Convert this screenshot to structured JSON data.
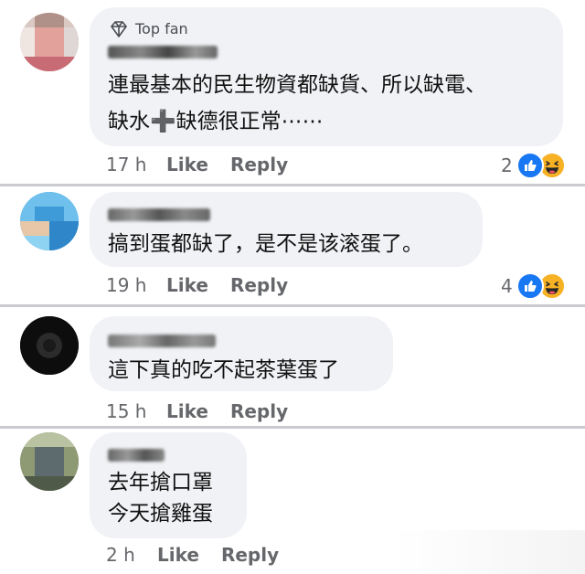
{
  "comments": [
    {
      "badge": "Top fan",
      "author": "Mary Chan",
      "lines": [
        "連最基本的民生物資都缺貨、所以缺電、",
        "缺水➕缺德很正常⋯⋯"
      ],
      "time": "17 h",
      "like_label": "Like",
      "reply_label": "Reply",
      "reactions_count": "2"
    },
    {
      "author": "Steven Wei",
      "lines": [
        "搞到蛋都缺了，是不是该滚蛋了。"
      ],
      "time": "19 h",
      "like_label": "Like",
      "reply_label": "Reply",
      "reactions_count": "4"
    },
    {
      "author": "Fortner Leo",
      "lines": [
        "這下真的吃不起茶葉蛋了"
      ],
      "time": "15 h",
      "like_label": "Like",
      "reply_label": "Reply"
    },
    {
      "author": "",
      "lines": [
        "去年搶口罩",
        "今天搶雞蛋"
      ],
      "time": "2 h",
      "like_label": "Like",
      "reply_label": "Reply"
    }
  ],
  "icons": [
    "diamond-icon",
    "like-reaction-icon",
    "haha-reaction-icon"
  ],
  "colors": {
    "bubble": "#f0f2f5",
    "meta_text": "#65676b",
    "like_blue": "#1877f2",
    "haha_yellow": "#f7b125"
  }
}
